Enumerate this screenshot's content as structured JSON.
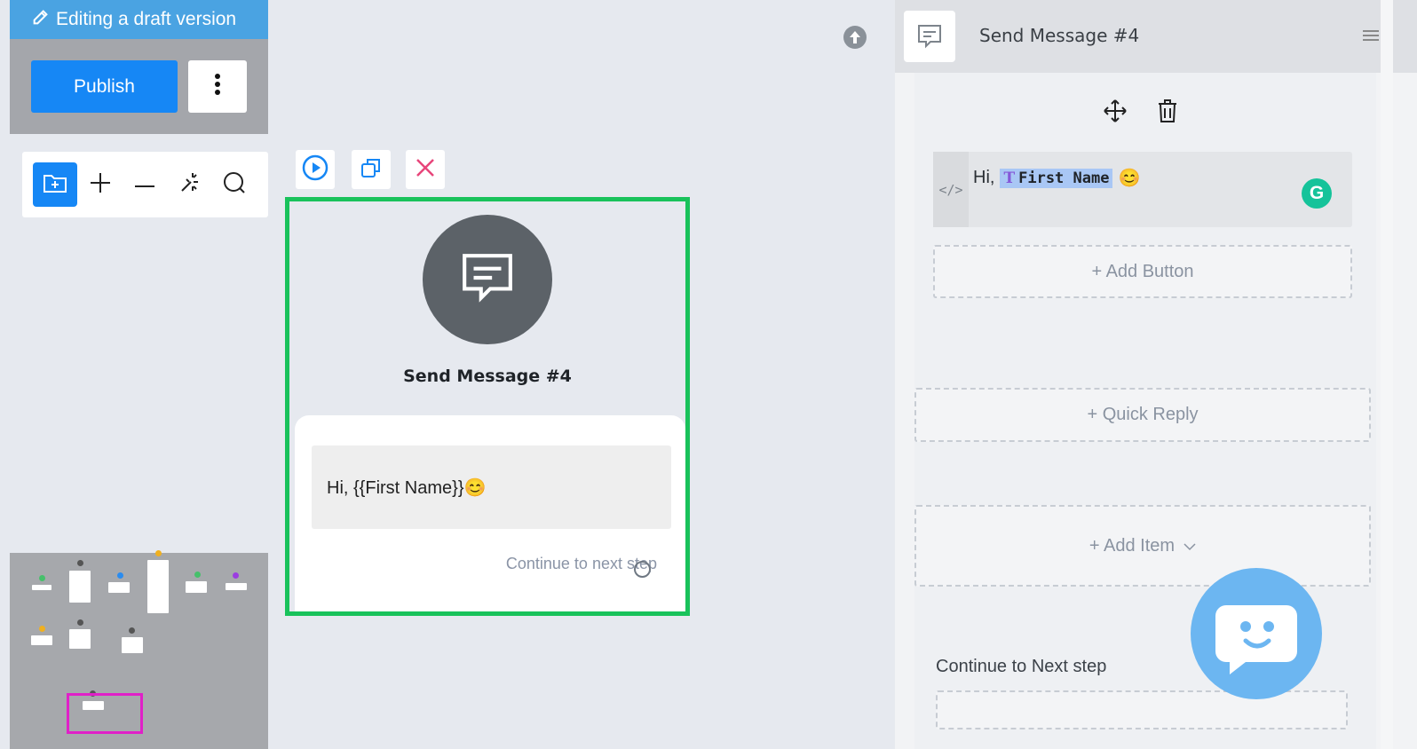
{
  "banner": {
    "text": "Editing a draft version"
  },
  "toolbar": {
    "publish_label": "Publish"
  },
  "node": {
    "title": "Send Message #4",
    "message": "Hi, {{First Name}}😊",
    "continue_label": "Continue to next step"
  },
  "panel": {
    "title": "Send Message #4",
    "greeting": "Hi,",
    "variable": "First Name",
    "emoji": "😊",
    "code_tag": "</>",
    "add_button": "+ Add Button",
    "quick_reply": "+ Quick Reply",
    "add_item": "+ Add Item",
    "continue_label": "Continue to Next step"
  },
  "colors": {
    "primary": "#1687f5",
    "banner": "#4aa3e2",
    "selection": "#19c25b",
    "minimap_viewport": "#e020c8",
    "grammarly": "#15c39a"
  },
  "icons": [
    "edit-icon",
    "kebab-icon",
    "add-folder-icon",
    "zoom-in-icon",
    "zoom-out-icon",
    "auto-arrange-icon",
    "search-icon",
    "upload-icon",
    "play-icon",
    "duplicate-icon",
    "delete-icon",
    "chat-icon",
    "move-icon",
    "trash-icon",
    "code-icon",
    "grammarly-icon",
    "chevron-down-icon",
    "chat-widget-icon"
  ]
}
